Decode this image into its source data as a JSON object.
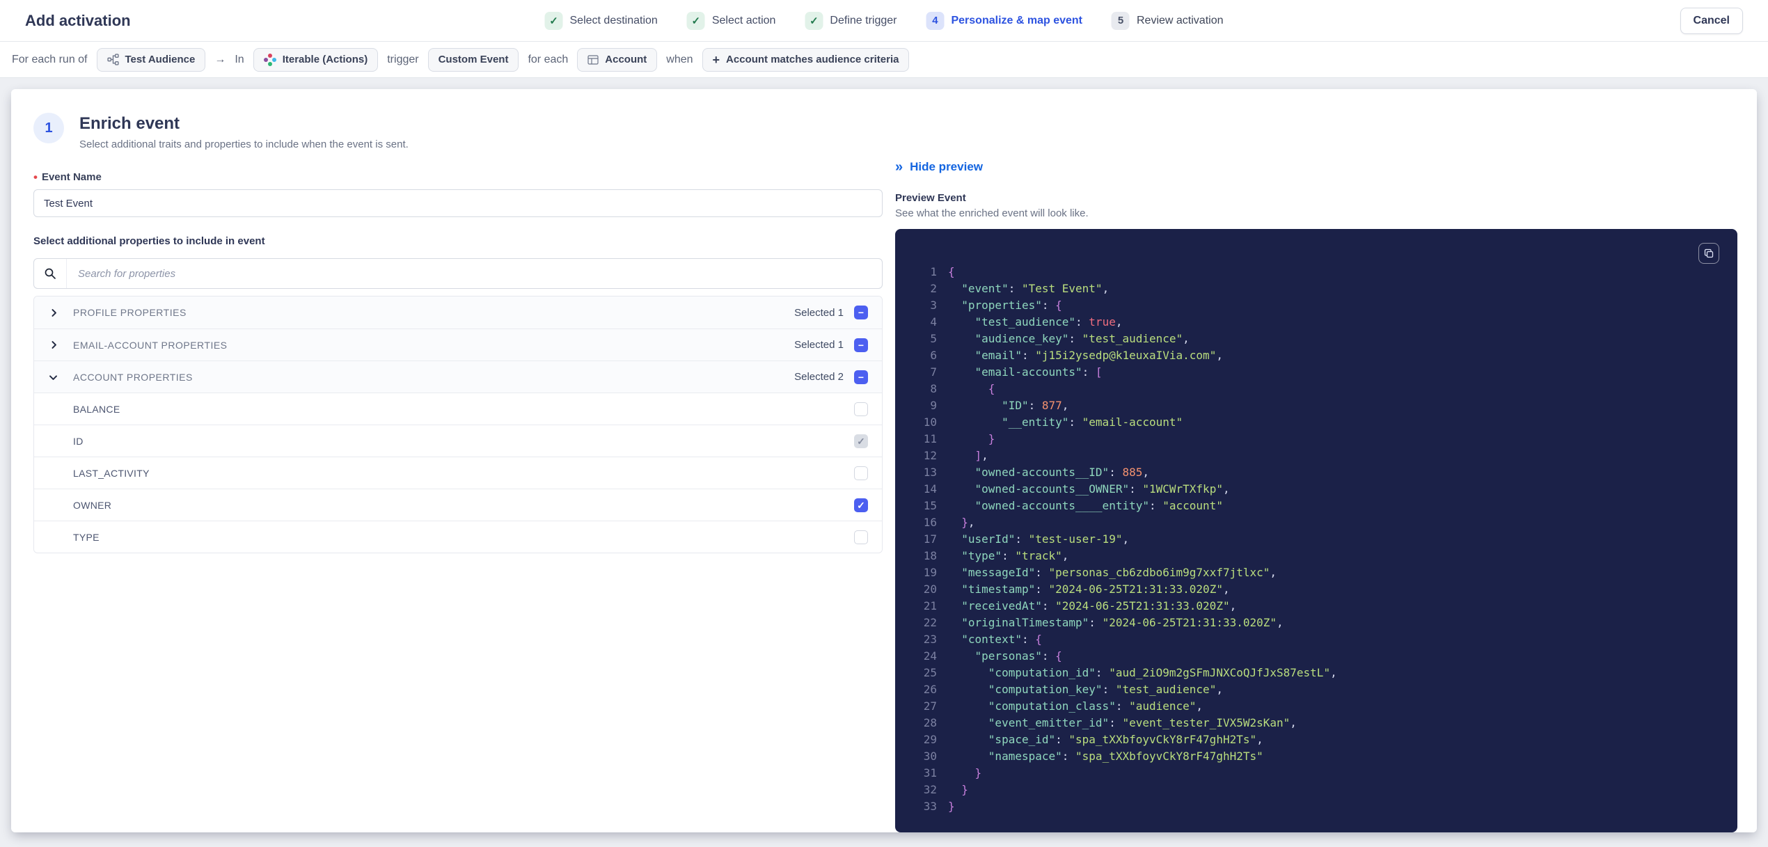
{
  "colors": {
    "accent_blue": "#2d53e0",
    "link_blue": "#1465e0",
    "success_green": "#217a4d",
    "success_bg": "#e2f2e9",
    "active_step_bg": "#dce3fb",
    "checkbox_blue": "#4c5ff0",
    "required_red": "#e5484d",
    "code_bg": "#1b2148",
    "code_line_number": "#7c81a2",
    "code_key": "#8fd7bd",
    "code_string": "#bade7e",
    "code_number": "#f4926f",
    "code_boolean": "#ef6d7f",
    "code_brace": "#c77fdc",
    "code_punct": "#d7dbef",
    "iterable_red": "#d9415f",
    "iterable_blue": "#3fb8e8",
    "iterable_green": "#2bb673",
    "iterable_purple": "#8a4e9e"
  },
  "header": {
    "title": "Add activation",
    "cancel_label": "Cancel",
    "steps": [
      {
        "label": "Select destination",
        "state": "done"
      },
      {
        "label": "Select action",
        "state": "done"
      },
      {
        "label": "Define trigger",
        "state": "done"
      },
      {
        "number": "4",
        "label": "Personalize & map event",
        "state": "active"
      },
      {
        "number": "5",
        "label": "Review activation",
        "state": "upcoming"
      }
    ]
  },
  "context_bar": {
    "segments": [
      {
        "type": "text",
        "text": "For each run of"
      },
      {
        "type": "chip",
        "icon": "audience-icon",
        "label": "Test Audience"
      },
      {
        "type": "text",
        "text": "→"
      },
      {
        "type": "text",
        "text": "In"
      },
      {
        "type": "chip",
        "icon": "iterable-icon",
        "label": "Iterable (Actions)"
      },
      {
        "type": "text",
        "text": "trigger"
      },
      {
        "type": "chip",
        "label": "Custom Event"
      },
      {
        "type": "text",
        "text": "for each"
      },
      {
        "type": "chip",
        "icon": "table-icon",
        "label": "Account"
      },
      {
        "type": "text",
        "text": "when"
      },
      {
        "type": "chip",
        "icon": "plus-icon",
        "label": "Account matches audience criteria"
      }
    ]
  },
  "enrich": {
    "step_number": "1",
    "title": "Enrich event",
    "subtitle": "Select additional traits and properties to include when the event is sent.",
    "event_name_label": "Event Name",
    "event_name_value": "Test Event",
    "properties_label": "Select additional properties to include in event",
    "search_placeholder": "Search for properties",
    "groups": [
      {
        "label": "PROFILE PROPERTIES",
        "selected_label": "Selected 1",
        "expanded": false
      },
      {
        "label": "EMAIL-ACCOUNT PROPERTIES",
        "selected_label": "Selected 1",
        "expanded": false
      },
      {
        "label": "ACCOUNT PROPERTIES",
        "selected_label": "Selected 2",
        "expanded": true,
        "children": [
          {
            "label": "BALANCE",
            "state": "unchecked"
          },
          {
            "label": "ID",
            "state": "checked-muted"
          },
          {
            "label": "LAST_ACTIVITY",
            "state": "unchecked"
          },
          {
            "label": "OWNER",
            "state": "checked"
          },
          {
            "label": "TYPE",
            "state": "unchecked"
          }
        ]
      }
    ]
  },
  "preview": {
    "hide_label": "Hide preview",
    "title": "Preview Event",
    "subtitle": "See what the enriched event will look like.",
    "code_lines": [
      {
        "n": 1,
        "i": 0,
        "t": [
          [
            "{",
            "br"
          ]
        ]
      },
      {
        "n": 2,
        "i": 2,
        "t": [
          [
            "\"event\"",
            "k"
          ],
          [
            ": ",
            "p"
          ],
          [
            "\"Test Event\"",
            "s"
          ],
          [
            ",",
            "p"
          ]
        ]
      },
      {
        "n": 3,
        "i": 2,
        "t": [
          [
            "\"properties\"",
            "k"
          ],
          [
            ": ",
            "p"
          ],
          [
            "{",
            "br"
          ]
        ]
      },
      {
        "n": 4,
        "i": 4,
        "t": [
          [
            "\"test_audience\"",
            "k"
          ],
          [
            ": ",
            "p"
          ],
          [
            "true",
            "b"
          ],
          [
            ",",
            "p"
          ]
        ]
      },
      {
        "n": 5,
        "i": 4,
        "t": [
          [
            "\"audience_key\"",
            "k"
          ],
          [
            ": ",
            "p"
          ],
          [
            "\"test_audience\"",
            "s"
          ],
          [
            ",",
            "p"
          ]
        ]
      },
      {
        "n": 6,
        "i": 4,
        "t": [
          [
            "\"email\"",
            "k"
          ],
          [
            ": ",
            "p"
          ],
          [
            "\"j15i2ysedp@k1euxaIVia.com\"",
            "s"
          ],
          [
            ",",
            "p"
          ]
        ]
      },
      {
        "n": 7,
        "i": 4,
        "t": [
          [
            "\"email-accounts\"",
            "k"
          ],
          [
            ": ",
            "p"
          ],
          [
            "[",
            "br"
          ]
        ]
      },
      {
        "n": 8,
        "i": 6,
        "t": [
          [
            "{",
            "br"
          ]
        ]
      },
      {
        "n": 9,
        "i": 8,
        "t": [
          [
            "\"ID\"",
            "k"
          ],
          [
            ": ",
            "p"
          ],
          [
            "877",
            "n"
          ],
          [
            ",",
            "p"
          ]
        ]
      },
      {
        "n": 10,
        "i": 8,
        "t": [
          [
            "\"__entity\"",
            "k"
          ],
          [
            ": ",
            "p"
          ],
          [
            "\"email-account\"",
            "s"
          ]
        ]
      },
      {
        "n": 11,
        "i": 6,
        "t": [
          [
            "}",
            "br"
          ]
        ]
      },
      {
        "n": 12,
        "i": 4,
        "t": [
          [
            "]",
            "br"
          ],
          [
            ",",
            "p"
          ]
        ]
      },
      {
        "n": 13,
        "i": 4,
        "t": [
          [
            "\"owned-accounts__ID\"",
            "k"
          ],
          [
            ": ",
            "p"
          ],
          [
            "885",
            "n"
          ],
          [
            ",",
            "p"
          ]
        ]
      },
      {
        "n": 14,
        "i": 4,
        "t": [
          [
            "\"owned-accounts__OWNER\"",
            "k"
          ],
          [
            ": ",
            "p"
          ],
          [
            "\"1WCWrTXfkp\"",
            "s"
          ],
          [
            ",",
            "p"
          ]
        ]
      },
      {
        "n": 15,
        "i": 4,
        "t": [
          [
            "\"owned-accounts____entity\"",
            "k"
          ],
          [
            ": ",
            "p"
          ],
          [
            "\"account\"",
            "s"
          ]
        ]
      },
      {
        "n": 16,
        "i": 2,
        "t": [
          [
            "}",
            "br"
          ],
          [
            ",",
            "p"
          ]
        ]
      },
      {
        "n": 17,
        "i": 2,
        "t": [
          [
            "\"userId\"",
            "k"
          ],
          [
            ": ",
            "p"
          ],
          [
            "\"test-user-19\"",
            "s"
          ],
          [
            ",",
            "p"
          ]
        ]
      },
      {
        "n": 18,
        "i": 2,
        "t": [
          [
            "\"type\"",
            "k"
          ],
          [
            ": ",
            "p"
          ],
          [
            "\"track\"",
            "s"
          ],
          [
            ",",
            "p"
          ]
        ]
      },
      {
        "n": 19,
        "i": 2,
        "t": [
          [
            "\"messageId\"",
            "k"
          ],
          [
            ": ",
            "p"
          ],
          [
            "\"personas_cb6zdbo6im9g7xxf7jtlxc\"",
            "s"
          ],
          [
            ",",
            "p"
          ]
        ]
      },
      {
        "n": 20,
        "i": 2,
        "t": [
          [
            "\"timestamp\"",
            "k"
          ],
          [
            ": ",
            "p"
          ],
          [
            "\"2024-06-25T21:31:33.020Z\"",
            "s"
          ],
          [
            ",",
            "p"
          ]
        ]
      },
      {
        "n": 21,
        "i": 2,
        "t": [
          [
            "\"receivedAt\"",
            "k"
          ],
          [
            ": ",
            "p"
          ],
          [
            "\"2024-06-25T21:31:33.020Z\"",
            "s"
          ],
          [
            ",",
            "p"
          ]
        ]
      },
      {
        "n": 22,
        "i": 2,
        "t": [
          [
            "\"originalTimestamp\"",
            "k"
          ],
          [
            ": ",
            "p"
          ],
          [
            "\"2024-06-25T21:31:33.020Z\"",
            "s"
          ],
          [
            ",",
            "p"
          ]
        ]
      },
      {
        "n": 23,
        "i": 2,
        "t": [
          [
            "\"context\"",
            "k"
          ],
          [
            ": ",
            "p"
          ],
          [
            "{",
            "br"
          ]
        ]
      },
      {
        "n": 24,
        "i": 4,
        "t": [
          [
            "\"personas\"",
            "k"
          ],
          [
            ": ",
            "p"
          ],
          [
            "{",
            "br"
          ]
        ]
      },
      {
        "n": 25,
        "i": 6,
        "t": [
          [
            "\"computation_id\"",
            "k"
          ],
          [
            ": ",
            "p"
          ],
          [
            "\"aud_2iO9m2gSFmJNXCoQJfJxS87estL\"",
            "s"
          ],
          [
            ",",
            "p"
          ]
        ]
      },
      {
        "n": 26,
        "i": 6,
        "t": [
          [
            "\"computation_key\"",
            "k"
          ],
          [
            ": ",
            "p"
          ],
          [
            "\"test_audience\"",
            "s"
          ],
          [
            ",",
            "p"
          ]
        ]
      },
      {
        "n": 27,
        "i": 6,
        "t": [
          [
            "\"computation_class\"",
            "k"
          ],
          [
            ": ",
            "p"
          ],
          [
            "\"audience\"",
            "s"
          ],
          [
            ",",
            "p"
          ]
        ]
      },
      {
        "n": 28,
        "i": 6,
        "t": [
          [
            "\"event_emitter_id\"",
            "k"
          ],
          [
            ": ",
            "p"
          ],
          [
            "\"event_tester_IVX5W2sKan\"",
            "s"
          ],
          [
            ",",
            "p"
          ]
        ]
      },
      {
        "n": 29,
        "i": 6,
        "t": [
          [
            "\"space_id\"",
            "k"
          ],
          [
            ": ",
            "p"
          ],
          [
            "\"spa_tXXbfoyvCkY8rF47ghH2Ts\"",
            "s"
          ],
          [
            ",",
            "p"
          ]
        ]
      },
      {
        "n": 30,
        "i": 6,
        "t": [
          [
            "\"namespace\"",
            "k"
          ],
          [
            ": ",
            "p"
          ],
          [
            "\"spa_tXXbfoyvCkY8rF47ghH2Ts\"",
            "s"
          ]
        ]
      },
      {
        "n": 31,
        "i": 4,
        "t": [
          [
            "}",
            "br"
          ]
        ]
      },
      {
        "n": 32,
        "i": 2,
        "t": [
          [
            "}",
            "br"
          ]
        ]
      },
      {
        "n": 33,
        "i": 0,
        "t": [
          [
            "}",
            "br"
          ]
        ]
      }
    ]
  }
}
